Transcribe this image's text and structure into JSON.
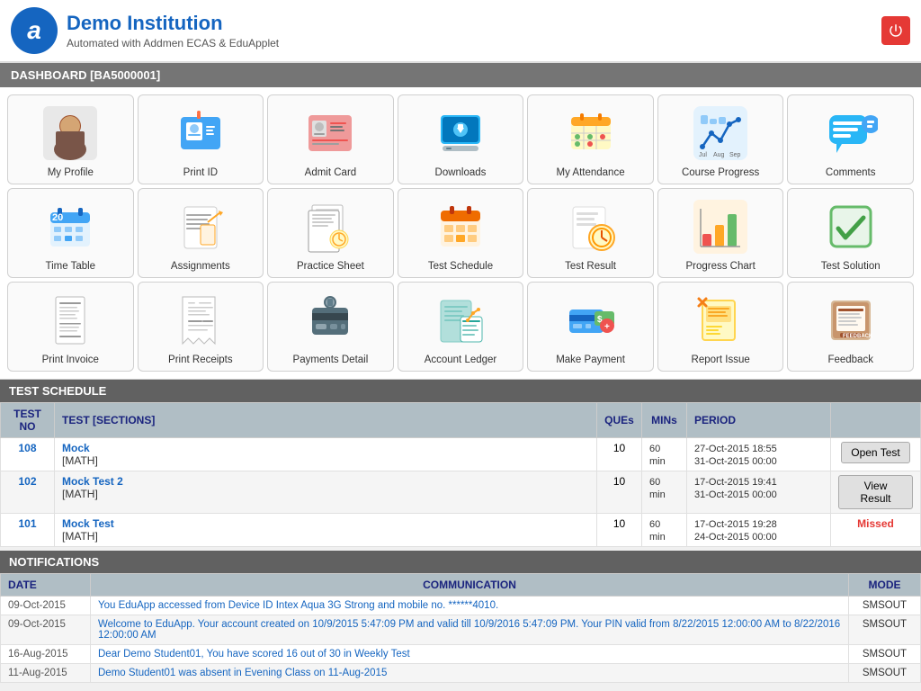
{
  "header": {
    "logo_letter": "a",
    "institution": "Demo Institution",
    "subtitle": "Automated with Addmen ECAS & EduApplet",
    "power_icon": "⏻"
  },
  "dashboard": {
    "label": "DASHBOARD [BA5000001]"
  },
  "icons": [
    {
      "id": "my-profile",
      "label": "My Profile",
      "icon": "profile",
      "color": "#888"
    },
    {
      "id": "print-id",
      "label": "Print ID",
      "icon": "id-card",
      "color": "#42a5f5"
    },
    {
      "id": "admit-card",
      "label": "Admit Card",
      "icon": "admit",
      "color": "#ef5350"
    },
    {
      "id": "downloads",
      "label": "Downloads",
      "icon": "downloads",
      "color": "#29b6f6"
    },
    {
      "id": "my-attendance",
      "label": "My Attendance",
      "icon": "attendance",
      "color": "#ffa726"
    },
    {
      "id": "course-progress",
      "label": "Course Progress",
      "icon": "chart-line",
      "color": "#66bb6a"
    },
    {
      "id": "comments",
      "label": "Comments",
      "icon": "chat",
      "color": "#29b6f6"
    },
    {
      "id": "time-table",
      "label": "Time Table",
      "icon": "timetable",
      "color": "#42a5f5"
    },
    {
      "id": "assignments",
      "label": "Assignments",
      "icon": "assignments",
      "color": "#5c6bc0"
    },
    {
      "id": "practice-sheet",
      "label": "Practice Sheet",
      "icon": "practice",
      "color": "#78909c"
    },
    {
      "id": "test-schedule",
      "label": "Test Schedule",
      "icon": "calendar",
      "color": "#ef6c00"
    },
    {
      "id": "test-result",
      "label": "Test Result",
      "icon": "test-result",
      "color": "#ffa726"
    },
    {
      "id": "progress-chart",
      "label": "Progress Chart",
      "icon": "bar-chart",
      "color": "#ef5350"
    },
    {
      "id": "test-solution",
      "label": "Test Solution",
      "icon": "checkmark",
      "color": "#66bb6a"
    },
    {
      "id": "print-invoice",
      "label": "Print Invoice",
      "icon": "invoice",
      "color": "#90a4ae"
    },
    {
      "id": "print-receipts",
      "label": "Print Receipts",
      "icon": "receipt",
      "color": "#90a4ae"
    },
    {
      "id": "payments-detail",
      "label": "Payments Detail",
      "icon": "pos",
      "color": "#546e7a"
    },
    {
      "id": "account-ledger",
      "label": "Account Ledger",
      "icon": "ledger",
      "color": "#26a69a"
    },
    {
      "id": "make-payment",
      "label": "Make Payment",
      "icon": "credit-card",
      "color": "#42a5f5"
    },
    {
      "id": "report-issue",
      "label": "Report Issue",
      "icon": "sticky-note",
      "color": "#ffd54f"
    },
    {
      "id": "feedback",
      "label": "Feedback",
      "icon": "feedback-box",
      "color": "#a1887f"
    }
  ],
  "test_schedule": {
    "section_label": "TEST SCHEDULE",
    "headers": [
      "TEST NO",
      "TEST [SECTIONS]",
      "QUEs",
      "MINs",
      "PERIOD",
      ""
    ],
    "rows": [
      {
        "no": "108",
        "name": "Mock",
        "sections": "[MATH]",
        "ques": "10",
        "mins": "60 min",
        "period_start": "27-Oct-2015 18:55",
        "period_end": "31-Oct-2015 00:00",
        "action": "Open Test",
        "action_type": "button"
      },
      {
        "no": "102",
        "name": "Mock Test 2",
        "sections": "[MATH]",
        "ques": "10",
        "mins": "60 min",
        "period_start": "17-Oct-2015 19:41",
        "period_end": "31-Oct-2015 00:00",
        "action": "View Result",
        "action_type": "button"
      },
      {
        "no": "101",
        "name": "Mock Test",
        "sections": "[MATH]",
        "ques": "10",
        "mins": "60 min",
        "period_start": "17-Oct-2015 19:28",
        "period_end": "24-Oct-2015 00:00",
        "action": "Missed",
        "action_type": "text"
      }
    ]
  },
  "notifications": {
    "section_label": "NOTIFICATIONS",
    "headers": [
      "DATE",
      "COMMUNICATION",
      "MODE"
    ],
    "rows": [
      {
        "date": "09-Oct-2015",
        "message": "You EduApp accessed from Device ID Intex Aqua 3G Strong and mobile no. ******4010.",
        "mode": "SMSOUT"
      },
      {
        "date": "09-Oct-2015",
        "message": "Welcome to EduApp. Your account created on 10/9/2015 5:47:09 PM and valid till 10/9/2016 5:47:09 PM. Your PIN valid from 8/22/2015 12:00:00 AM to 8/22/2016 12:00:00 AM",
        "mode": "SMSOUT"
      },
      {
        "date": "16-Aug-2015",
        "message": "Dear Demo Student01, You have scored 16 out of 30 in Weekly Test",
        "mode": "SMSOUT"
      },
      {
        "date": "11-Aug-2015",
        "message": "Demo Student01 was absent in Evening Class on 11-Aug-2015",
        "mode": "SMSOUT"
      }
    ]
  }
}
